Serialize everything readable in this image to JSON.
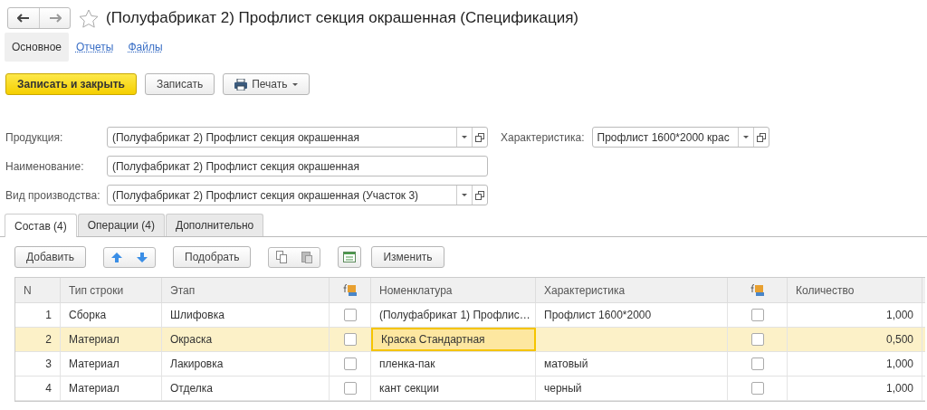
{
  "window": {
    "title": "(Полуфабрикат 2) Профлист секция окрашенная (Спецификация)"
  },
  "sections": [
    {
      "label": "Основное",
      "selected": true
    },
    {
      "label": "Отчеты",
      "selected": false
    },
    {
      "label": "Файлы",
      "selected": false
    }
  ],
  "commands": [
    {
      "kind": "primary",
      "label": "Записать и закрыть"
    },
    {
      "kind": "plain",
      "label": "Записать"
    },
    {
      "kind": "print",
      "label": "Печать"
    }
  ],
  "fields": [
    {
      "label": "Продукция:",
      "value": "(Полуфабрикат 2) Профлист секция окрашенная",
      "kind": "select"
    },
    {
      "label": "Наименование:",
      "value": "(Полуфабрикат 2) Профлист секция окрашенная",
      "kind": "text"
    },
    {
      "label": "Вид производства:",
      "value": "(Полуфабрикат 2) Профлист секция окрашенная (Участок 3)",
      "kind": "select"
    }
  ],
  "characteristic": {
    "label": "Характеристика:",
    "value": "Профлист 1600*2000 крас"
  },
  "tabs": [
    {
      "label": "Состав (4)",
      "selected": true
    },
    {
      "label": "Операции (4)",
      "selected": false
    },
    {
      "label": "Дополнительно",
      "selected": false
    }
  ],
  "toolbar": [
    {
      "kind": "button",
      "label": "Добавить"
    },
    {
      "kind": "move"
    },
    {
      "kind": "button",
      "label": "Подобрать"
    },
    {
      "kind": "clipboard"
    },
    {
      "kind": "settings"
    },
    {
      "kind": "button",
      "label": "Изменить"
    }
  ],
  "table": {
    "columns": [
      {
        "kind": "text",
        "label": "N"
      },
      {
        "kind": "text",
        "label": "Тип строки"
      },
      {
        "kind": "text",
        "label": "Этап"
      },
      {
        "kind": "formula"
      },
      {
        "kind": "text",
        "label": "Номенклатура"
      },
      {
        "kind": "text",
        "label": "Характеристика"
      },
      {
        "kind": "formula"
      },
      {
        "kind": "text",
        "label": "Количество"
      }
    ],
    "rows": [
      {
        "n": "1",
        "type": "Сборка",
        "stage": "Шлифовка",
        "stage_flag": false,
        "item": "(Полуфабрикат 1) Профлис…",
        "item_focused": false,
        "characteristic": "Профлист 1600*2000",
        "char_flag": false,
        "quantity": "1,000",
        "selected": false
      },
      {
        "n": "2",
        "type": "Материал",
        "stage": "Окраска",
        "stage_flag": false,
        "item": "Краска Стандартная",
        "item_focused": true,
        "characteristic": "",
        "char_flag": false,
        "quantity": "0,500",
        "selected": true
      },
      {
        "n": "3",
        "type": "Материал",
        "stage": "Лакировка",
        "stage_flag": false,
        "item": "пленка-пак",
        "item_focused": false,
        "characteristic": "матовый",
        "char_flag": false,
        "quantity": "1,000",
        "selected": false
      },
      {
        "n": "4",
        "type": "Материал",
        "stage": "Отделка",
        "stage_flag": false,
        "item": "кант секции",
        "item_focused": false,
        "characteristic": "черный",
        "char_flag": false,
        "quantity": "1,000",
        "selected": false
      }
    ]
  }
}
